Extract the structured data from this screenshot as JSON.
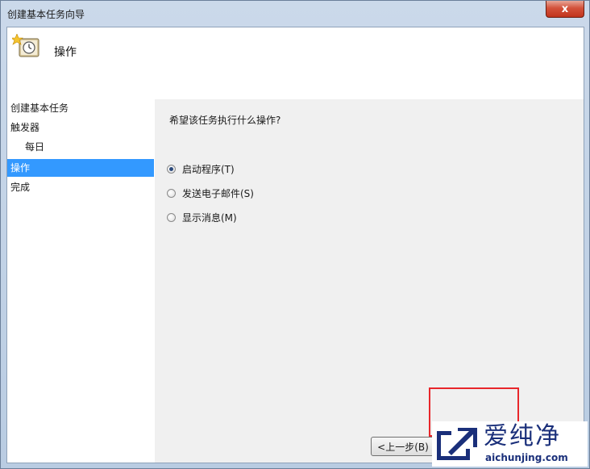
{
  "window": {
    "title": "创建基本任务向导",
    "close_glyph": "x"
  },
  "header": {
    "icon": "task-clock-icon",
    "title": "操作"
  },
  "nav": {
    "items": [
      {
        "label": "创建基本任务"
      },
      {
        "label": "触发器"
      },
      {
        "label": "每日"
      },
      {
        "label": "操作"
      },
      {
        "label": "完成"
      }
    ]
  },
  "content": {
    "question": "希望该任务执行什么操作?",
    "options": [
      {
        "label": "启动程序(T)",
        "checked": true
      },
      {
        "label": "发送电子邮件(S)",
        "checked": false
      },
      {
        "label": "显示消息(M)",
        "checked": false
      }
    ]
  },
  "footer": {
    "back_label": "<上一步(B)"
  },
  "watermark": {
    "name": "爱纯净",
    "url": "aichunjing.com"
  },
  "colors": {
    "selection": "#3399ff",
    "highlight_box": "#e8262b",
    "watermark": "#1a2f7a"
  }
}
